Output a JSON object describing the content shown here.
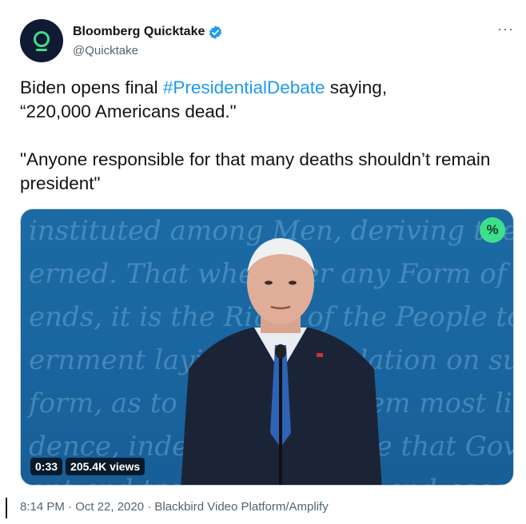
{
  "author": {
    "display_name": "Bloomberg Quicktake",
    "handle": "@Quicktake",
    "avatar_icon": "quicktake-logo-icon",
    "verified_icon": "verified-badge-icon"
  },
  "more_label": "···",
  "tweet": {
    "text_before": "Biden opens final ",
    "hashtag": "#PresidentialDebate",
    "text_after": " saying,\n“220,000 Americans dead.\"\n\n\"Anyone responsible for that many deaths shouldn’t remain president\""
  },
  "media": {
    "duration": "0:33",
    "views": "205.4K views",
    "badge_label": "%",
    "background_text": [
      "instituted among Men, deriving their just",
      "erned. That whenever any Form of Gover",
      "ends, it is the Right of the People to alter or to",
      "ernment laying its foundation on such principles",
      "form, as to them shall seem most likely to effect",
      "dence, indeed, will dictate that Governments",
      "ent and transient causes; and accordingly"
    ]
  },
  "meta": {
    "text": "8:14 PM · Oct 22, 2020 · Blackbird Video Platform/Amplify"
  },
  "colors": {
    "link": "#1d9bf0",
    "avatar_bg": "#111a33",
    "badge": "#3de08a"
  }
}
